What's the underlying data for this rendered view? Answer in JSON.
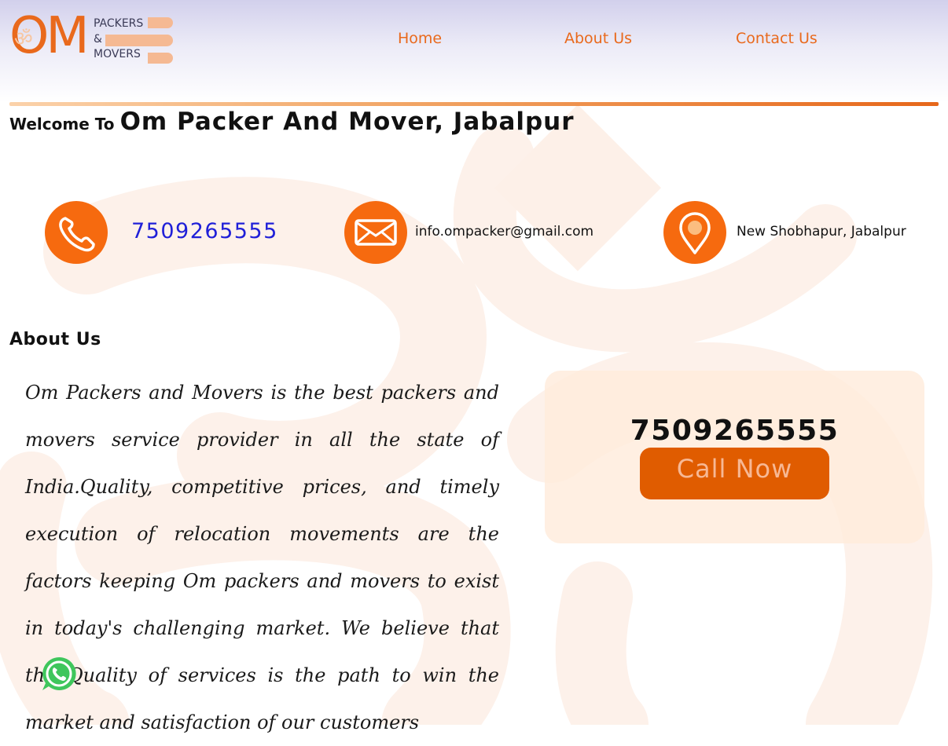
{
  "header": {
    "logo": {
      "letters": "OM",
      "line1": "PACKERS",
      "line2": "&",
      "line3": "MOVERS"
    },
    "nav": [
      {
        "label": "Home"
      },
      {
        "label": "About Us"
      },
      {
        "label": "Contact Us"
      }
    ]
  },
  "welcome": {
    "prefix": "Welcome To",
    "title": "Om Packer And Mover, Jabalpur"
  },
  "contact": {
    "phone": "7509265555",
    "email": "info.ompacker@gmail.com",
    "address": "New Shobhapur, Jabalpur"
  },
  "about": {
    "heading": "About Us",
    "body": "Om Packers and Movers is the best packers and movers service provider in all the state of India.Quality, competitive prices, and timely execution of relocation movements are the factors keeping Om packers and movers to exist in today's challenging market. We believe that the Quality of services is the path to win the market and satisfaction of our customers"
  },
  "call_card": {
    "number": "7509265555",
    "button_label": "Call Now"
  },
  "icons": {
    "contact_icons": [
      "phone-icon",
      "mail-icon",
      "location-pin-icon"
    ],
    "floating": "whatsapp-icon"
  },
  "colors": {
    "accent": "#e9691c",
    "icon_bg": "#f66a0f",
    "button": "#e05c00",
    "phone_link": "#1f1fd8",
    "whatsapp": "#3fc65c"
  }
}
